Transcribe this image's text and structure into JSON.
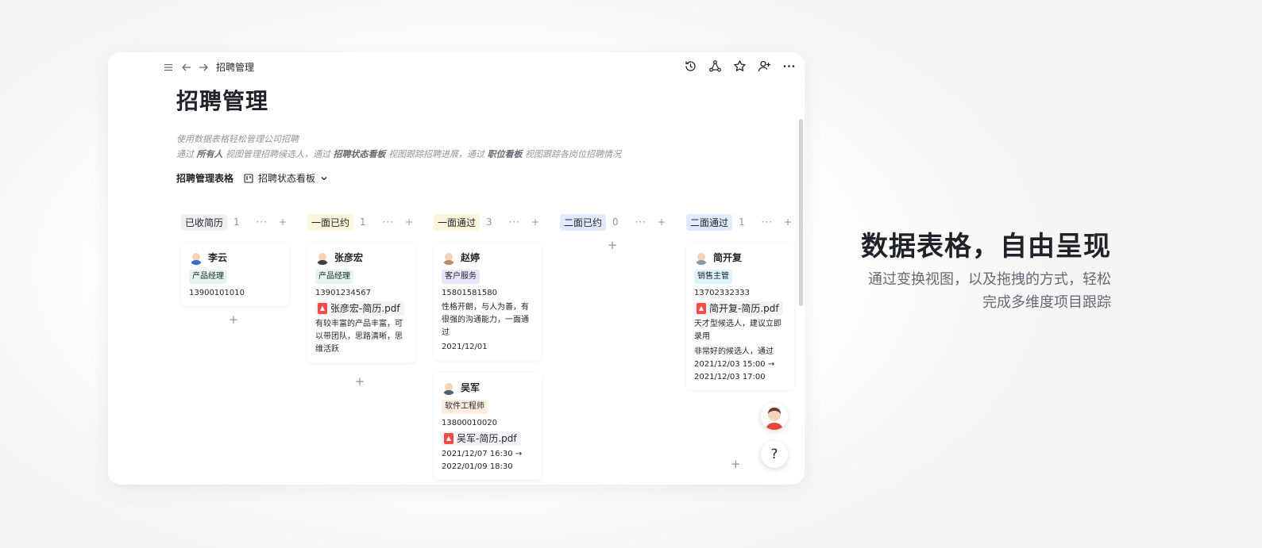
{
  "topbar": {
    "breadcrumb": "招聘管理",
    "icons": [
      "menu-icon",
      "back-arrow-icon",
      "forward-arrow-icon",
      "history-icon",
      "share-network-icon",
      "star-icon",
      "add-user-icon",
      "more-icon"
    ]
  },
  "page": {
    "title": "招聘管理",
    "desc_line1": "使用数据表格轻松管理公司招聘",
    "desc_line2_parts": [
      "通过 ",
      "所有人",
      " 视图管理招聘候选人，通过 ",
      "招聘状态看板",
      " 视图跟踪招聘进展，通过 ",
      "职位看板",
      " 视图跟踪各岗位招聘情况"
    ]
  },
  "views": {
    "table_label": "招聘管理表格",
    "board_label": "招聘状态看板"
  },
  "board": {
    "columns": [
      {
        "name": "已收简历",
        "count": "1",
        "color": "#eff0f1"
      },
      {
        "name": "一面已约",
        "count": "1",
        "color": "#fbf6dc"
      },
      {
        "name": "一面通过",
        "count": "3",
        "color": "#fbf6dc"
      },
      {
        "name": "二面已约",
        "count": "0",
        "color": "#e1eaff"
      },
      {
        "name": "二面通过",
        "count": "1",
        "color": "#e1eaff"
      }
    ],
    "more_label": "···",
    "add_label": "+",
    "cards": {
      "liyun": {
        "name": "李云",
        "position": "产品经理",
        "phone": "13900101010"
      },
      "zhangyanhong": {
        "name": "张彦宏",
        "position": "产品经理",
        "phone": "13901234567",
        "file": "张彦宏-简历.pdf",
        "note": "有较丰富的产品丰富，可以带团队，思路清晰，思维活跃"
      },
      "zhaoting": {
        "name": "赵婷",
        "position": "客户服务",
        "phone": "15801581580",
        "note": "性格开朗，与人为善，有很强的沟通能力，一面通过",
        "date": "2021/12/01"
      },
      "wujun": {
        "name": "吴军",
        "position": "软件工程师",
        "phone": "13800010020",
        "file": "吴军-简历.pdf",
        "date": "2021/12/07 16:30 → 2022/01/09 18:30"
      },
      "jiankaifu": {
        "name": "简开复",
        "position": "销售主管",
        "phone": "13702332333",
        "file": "简开复-简历.pdf",
        "note1": "天才型候选人，建议立即录用",
        "note2": "非常好的候选人，通过",
        "date": "2021/12/03 15:00 → 2021/12/03 17:00"
      }
    }
  },
  "help_label": "?",
  "marketing": {
    "headline": "数据表格，自由呈现",
    "subline_line1": "通过变换视图，以及拖拽的方式，轻松",
    "subline_line2": "完成多维度项目跟踪"
  }
}
